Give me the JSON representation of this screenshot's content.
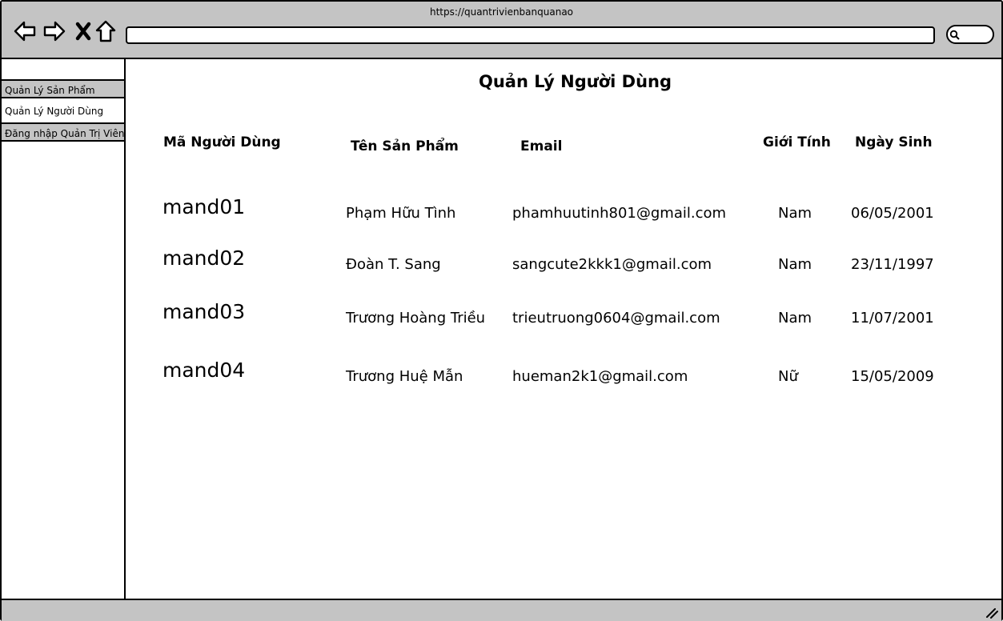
{
  "browser": {
    "url": "https://quantrivienbanquanao",
    "address_value": "",
    "nav_icons": [
      "back-arrow-icon",
      "forward-arrow-icon",
      "close-x-icon",
      "home-icon"
    ],
    "search_icon": "search-icon"
  },
  "sidebar": {
    "items": [
      {
        "label": "Quản Lý Sản Phẩm",
        "style": "gray"
      },
      {
        "label": "Quản Lý Người Dùng",
        "style": "white"
      },
      {
        "label": "Đăng nhập Quản Trị Viên",
        "style": "gray"
      }
    ]
  },
  "main": {
    "title": "Quản Lý Người Dùng",
    "columns": [
      "Mã Người Dùng",
      "Tên Sản Phẩm",
      "Email",
      "Giới Tính",
      "Ngày Sinh"
    ],
    "rows": [
      {
        "id": "mand01",
        "name": "Phạm Hữu Tình",
        "email": "phamhuutinh801@gmail.com",
        "gender": "Nam",
        "dob": "06/05/2001"
      },
      {
        "id": "mand02",
        "name": "Đoàn T. Sang",
        "email": "sangcute2kkk1@gmail.com",
        "gender": "Nam",
        "dob": "23/11/1997"
      },
      {
        "id": "mand03",
        "name": "Trương Hoàng Triều",
        "email": "trieutruong0604@gmail.com",
        "gender": "Nam",
        "dob": "11/07/2001"
      },
      {
        "id": "mand04",
        "name": "Trương Huệ Mẫn",
        "email": "hueman2k1@gmail.com",
        "gender": "Nữ",
        "dob": "15/05/2009"
      }
    ]
  },
  "colors": {
    "chrome": "#c4c4c4",
    "border": "#000000",
    "background": "#ffffff"
  }
}
